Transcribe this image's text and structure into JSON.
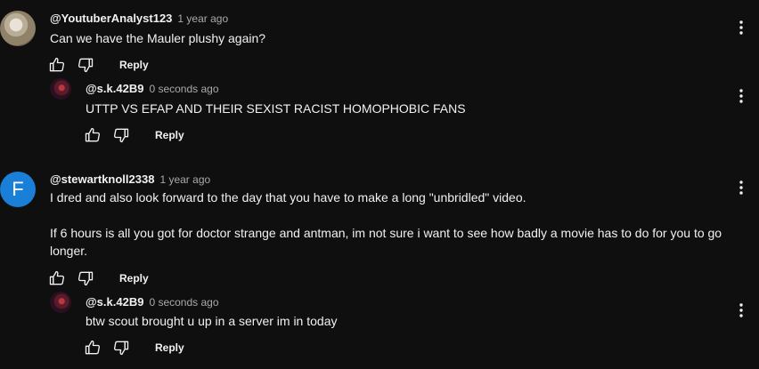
{
  "comments": [
    {
      "author": "@YoutuberAnalyst123",
      "time": "1 year ago",
      "text": [
        "Can we have the Mauler plushy again?"
      ],
      "reply_label": "Reply",
      "avatar_icon": "profile-photo"
    },
    {
      "author": "@s.k.42B9",
      "time": "0 seconds ago",
      "text": [
        "UTTP VS EFAP AND THEIR SEXIST RACIST HOMOPHOBIC FANS"
      ],
      "reply_label": "Reply",
      "avatar_icon": "profile-photo"
    },
    {
      "author": "@stewartknoll2338",
      "time": "1 year ago",
      "text": [
        "I dred and also look forward to the day that you have to make a long \"unbridled\" video.",
        "If 6 hours is all you got for doctor strange and antman, im not sure i want to see how badly a movie has to do for you to go longer."
      ],
      "reply_label": "Reply",
      "avatar_letter": "F",
      "avatar_color": "#1a7fd6"
    },
    {
      "author": "@s.k.42B9",
      "time": "0 seconds ago",
      "text": [
        "btw scout brought u up in a server im in today"
      ],
      "reply_label": "Reply",
      "avatar_icon": "profile-photo"
    }
  ],
  "icons": {
    "like": "thumbs-up-icon",
    "dislike": "thumbs-down-icon",
    "menu": "more-vert-icon"
  },
  "colors": {
    "background": "#0f0f0f",
    "text": "#f1f1f1",
    "secondary_text": "#aaaaaa"
  }
}
